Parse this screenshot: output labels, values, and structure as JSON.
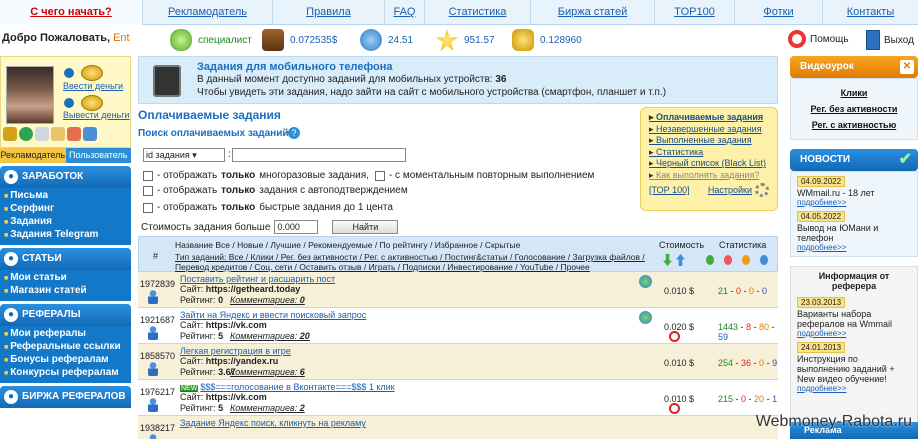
{
  "topnav": [
    "С чего начать?",
    "Рекламодатель",
    "Правила",
    "FAQ",
    "Статистика",
    "Биржа статей",
    "TOP100",
    "Фотки",
    "Контакты"
  ],
  "welcome": {
    "text": "Добро Пожаловать,",
    "nick": "Ent"
  },
  "stats": {
    "status": "специалист",
    "balance": "0.072535$",
    "level": "24.51",
    "rating": "951.57",
    "coins": "0.128960"
  },
  "top_right": {
    "help": "Помощь",
    "logout": "Выход"
  },
  "left": {
    "money_in": "Ввести деньги",
    "money_out": "Вывести деньги",
    "tab_advertiser": "Рекламодатель",
    "tab_user": "Пользователь",
    "sections": [
      {
        "title": "ЗАРАБОТОК",
        "items": [
          "Письма",
          "Серфинг",
          "Задания",
          "Задания Telegram"
        ]
      },
      {
        "title": "СТАТЬИ",
        "items": [
          "Мои статьи",
          "Магазин статей"
        ]
      },
      {
        "title": "РЕФЕРАЛЫ",
        "items": [
          "Мои рефералы",
          "Реферальные ссылки",
          "Бонусы рефералам",
          "Конкурсы рефералам"
        ]
      },
      {
        "title": "БИРЖА РЕФЕРАЛОВ",
        "items": []
      }
    ]
  },
  "mobile": {
    "title": "Задания для мобильного телефона",
    "line1": "В данный момент доступно заданий для мобильных устройств:",
    "count": "36",
    "line2": "Чтобы увидеть эти задания, надо зайти на сайт с мобильного устройства (смартфон, планшет и т.п.)"
  },
  "main": {
    "heading": "Оплачиваемые задания",
    "search_label": "Поиск оплачиваемых заданий:",
    "search_select": "id задания",
    "checks": [
      {
        "a": "- отображать ",
        "b": "только",
        "c": " многоразовые задания,",
        "d": "- с моментальным повторным выполнением"
      },
      {
        "a": "- отображать ",
        "b": "только",
        "c": " задания с автоподтверждением"
      },
      {
        "a": "- отображать ",
        "b": "только",
        "c": " быстрые задания до 1 цента"
      }
    ],
    "cost_label": "Стоимость задания больше",
    "cost_value": "0.000",
    "find": "Найти"
  },
  "yellow": {
    "items": [
      "Оплачиваемые задания",
      "Незавершенные задания",
      "Выполненные задания",
      "Статистика",
      "Черный список (Black List)",
      "Как выполнять задания?"
    ],
    "top": "[ТОР 100]",
    "settings": "Настройки"
  },
  "table": {
    "h_num": "#",
    "h_cost": "Стоимость",
    "h_stat": "Статистика",
    "name_line": "Название Все / Новые / Лучшие / Рекомендуемые / По рейтингу / Избранное / Скрытые",
    "type_line": "Тип заданий: Все / Клики / Рег. без активности / Рег. с активностью / Постинг&статьи / Голосование / Загрузка файлов / Перевод кредитов / Соц. сети / Оставить отзыв / Играть / Подписки / Инвестирование / YouTube / Прочее",
    "site_label": "Сайт:",
    "rating_label": "Рейтинг:",
    "comments_label": "Комментариев:",
    "rows": [
      {
        "id": "1972839",
        "title": "Поставить рейтинг и расшарить пост",
        "site": "https://getheard.today",
        "rating": "0",
        "comments": "0",
        "cost": "0.010 $",
        "s": [
          "21",
          "0",
          "0",
          "0"
        ],
        "isnew": ""
      },
      {
        "id": "1921687",
        "title": "Зайти на Яндекс и ввести поисковый запрос",
        "site": "https://vk.com",
        "rating": "5",
        "comments": "20",
        "cost": "0.020 $",
        "s": [
          "1443",
          "8",
          "80",
          "59"
        ],
        "isnew": ""
      },
      {
        "id": "1858570",
        "title": "Легкая регистрация в игре",
        "site": "https://yandex.ru",
        "rating": "3.67",
        "comments": "6",
        "cost": "0.010 $",
        "s": [
          "254",
          "36",
          "0",
          "9"
        ],
        "isnew": ""
      },
      {
        "id": "1976217",
        "title": "$$$===голосование в Вконтакте===$$$ 1 клик",
        "site": "https://vk.com",
        "rating": "5",
        "comments": "2",
        "cost": "0.010 $",
        "s": [
          "215",
          "0",
          "20",
          "1"
        ],
        "isnew": "NEW"
      },
      {
        "id": "1938217",
        "title": "Задание Яндекс поиск, кликнуть на рекламу",
        "site": "",
        "rating": "",
        "comments": "",
        "cost": "",
        "s": [
          "",
          "",
          "",
          ""
        ],
        "isnew": ""
      }
    ]
  },
  "right": {
    "video": "Видеоурок",
    "links": [
      "Клики",
      "Рег. без активности",
      "Рег. с активностью"
    ],
    "news_title": "НОВОСТИ",
    "news": [
      {
        "date": "04.09.2022",
        "text": "WMmail.ru - 18 лет",
        "more": "подробнее>>"
      },
      {
        "date": "04.05.2022",
        "text": "Вывод на ЮMани и телефон",
        "more": "подробнее>>"
      }
    ],
    "ref_title": "Информация от реферера",
    "ref": [
      {
        "date": "23.03.2013",
        "text": "Варианты набора рефералов на Wmmail",
        "more": "подробнее>>"
      },
      {
        "date": "24.01.2013",
        "text": "Инструкция по выполнению заданий + New видео обучение!",
        "more": "подробнее>>"
      }
    ],
    "bottom": "Реклама"
  },
  "watermark": "Webmoney-Rabota.ru"
}
